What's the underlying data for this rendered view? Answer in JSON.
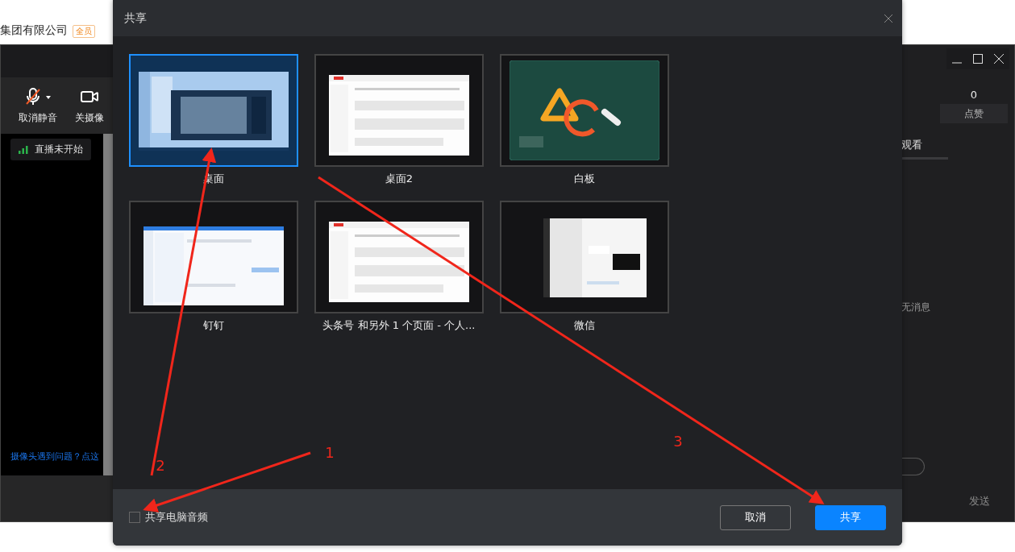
{
  "browser_bar": {
    "company": "集团有限公司",
    "badge": "全员"
  },
  "live_window": {
    "toolbar": [
      {
        "label": "取消静音",
        "kind": "mic_muted"
      },
      {
        "label": "关摄像",
        "kind": "camera"
      }
    ],
    "status": "直播未开始",
    "help_link": "摄像头遇到问题？点这",
    "likes": {
      "count": "0",
      "label": "点赞"
    },
    "tab": "观看",
    "empty_message": "无消息",
    "send_button": "发送"
  },
  "dialog": {
    "title": "共享",
    "sources": [
      {
        "label": "桌面",
        "kind": "desktop",
        "selected": true
      },
      {
        "label": "桌面2",
        "kind": "webpage",
        "selected": false
      },
      {
        "label": "白板",
        "kind": "whiteboard",
        "selected": false
      },
      {
        "label": "钉钉",
        "kind": "desktop_light",
        "selected": false
      },
      {
        "label": "头条号 和另外 1 个页面 - 个人...",
        "kind": "webpage",
        "selected": false
      },
      {
        "label": "微信",
        "kind": "chat",
        "selected": false
      }
    ],
    "share_audio": {
      "label": "共享电脑音频",
      "checked": false
    },
    "buttons": [
      {
        "label": "取消",
        "kind": "secondary"
      },
      {
        "label": "共享",
        "kind": "primary"
      }
    ]
  },
  "annotations": [
    {
      "label": "1"
    },
    {
      "label": "2"
    },
    {
      "label": "3"
    }
  ]
}
